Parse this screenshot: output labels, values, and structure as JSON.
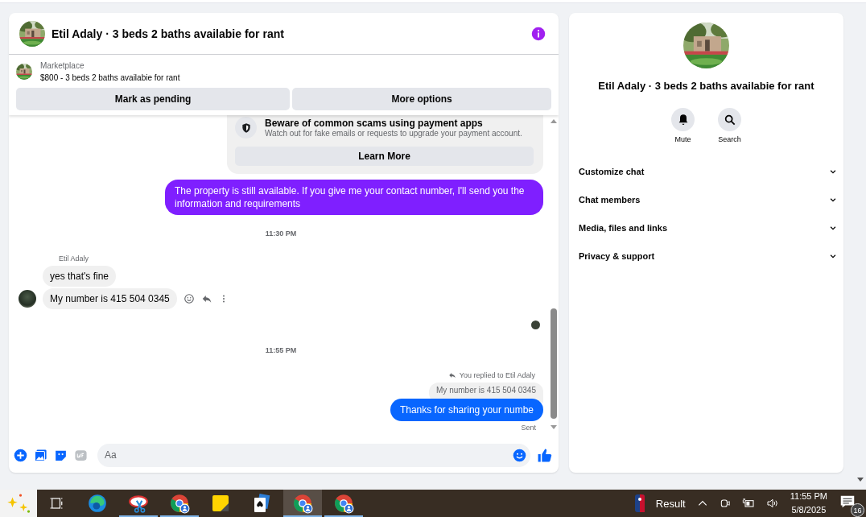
{
  "chat": {
    "header": {
      "title": "Etil Adaly · 3 beds 2 baths availabie for rant"
    },
    "listing": {
      "source": "Marketplace",
      "title": "$800 - 3 beds 2 baths availabie for rant",
      "buttons": [
        "Mark as pending",
        "More options"
      ]
    },
    "notice": {
      "title": "Beware of common scams using payment apps",
      "text": "Watch out for fake emails or requests to upgrade your payment account.",
      "button": "Learn More"
    },
    "messages": [
      {
        "kind": "outgoing",
        "text": "The property is still available. If you give me your contact number, I'll send you the information and requirements",
        "color": "#7f1fff"
      },
      {
        "kind": "time",
        "text": "11:30 PM"
      },
      {
        "kind": "sender",
        "text": "Etil Adaly"
      },
      {
        "kind": "incoming",
        "text": "yes that's fine",
        "avatar": false,
        "hovered": false
      },
      {
        "kind": "incoming",
        "text": "My number is 415 504 0345",
        "avatar": true,
        "hovered": true
      },
      {
        "kind": "seen"
      },
      {
        "kind": "time",
        "text": "11:55 PM"
      },
      {
        "kind": "reply_note",
        "text": "You replied to Etil Adaly"
      },
      {
        "kind": "quoted",
        "text": "My number is 415 504 0345"
      },
      {
        "kind": "outgoing",
        "text": "Thanks for sharing your numbe",
        "color": "#0866ff"
      },
      {
        "kind": "status",
        "text": "Sent"
      }
    ],
    "composer": {
      "placeholder": "Aa"
    }
  },
  "details": {
    "title": "Etil Adaly · 3 beds 2 baths availabie for rant",
    "actions": [
      {
        "kind": "mute",
        "label": "Mute"
      },
      {
        "kind": "search",
        "label": "Search"
      }
    ],
    "sections": [
      {
        "label": "Customize chat",
        "expanded": false
      },
      {
        "label": "Chat members",
        "expanded": false
      },
      {
        "label": "Media, files and links",
        "expanded": false
      },
      {
        "label": "Privacy & support",
        "expanded": false
      }
    ]
  },
  "taskbar": {
    "apps": [
      {
        "kind": "widgets",
        "selected": false,
        "running": false
      },
      {
        "kind": "taskview",
        "selected": false,
        "running": false
      },
      {
        "kind": "edge",
        "selected": false,
        "running": false
      },
      {
        "kind": "snip",
        "selected": false,
        "running": true
      },
      {
        "kind": "chrome",
        "selected": false,
        "running": true
      },
      {
        "kind": "sticky",
        "selected": false,
        "running": false
      },
      {
        "kind": "solitaire",
        "selected": false,
        "running": false
      },
      {
        "kind": "chrome",
        "selected": true,
        "running": true
      },
      {
        "kind": "chrome",
        "selected": false,
        "running": true
      }
    ],
    "news": "Result",
    "time": "11:55 PM",
    "date": "5/8/2025",
    "notifications": "16"
  }
}
